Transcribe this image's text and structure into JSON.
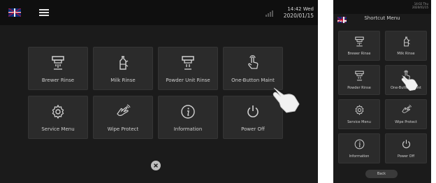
{
  "landscape": {
    "clock": {
      "time": "14:42 Wed",
      "date": "2020/01/15"
    },
    "tiles": [
      {
        "label": "Brewer Rinse",
        "icon": "brewer-rinse-icon"
      },
      {
        "label": "Milk Rinse",
        "icon": "milk-rinse-icon"
      },
      {
        "label": "Powder Unit Rinse",
        "icon": "powder-unit-rinse-icon"
      },
      {
        "label": "One-Button Maint",
        "icon": "touch-hand-icon"
      },
      {
        "label": "Service Menu",
        "icon": "gear-icon"
      },
      {
        "label": "Wipe Protect",
        "icon": "wipe-hand-icon"
      },
      {
        "label": "Information",
        "icon": "info-icon"
      },
      {
        "label": "Power Off",
        "icon": "power-icon"
      }
    ],
    "close_icon": "close-icon"
  },
  "portrait": {
    "status": {
      "time": "14:02 Thu",
      "date": "2020/01/15"
    },
    "title": "Shortcut Menu",
    "tiles": [
      {
        "label": "Brewer Rinse",
        "icon": "brewer-rinse-icon"
      },
      {
        "label": "Milk Rinse",
        "icon": "milk-rinse-icon"
      },
      {
        "label": "Powder Rinse",
        "icon": "powder-unit-rinse-icon"
      },
      {
        "label": "One-Button Maint",
        "icon": "touch-hand-icon"
      },
      {
        "label": "Service Menu",
        "icon": "gear-icon"
      },
      {
        "label": "Wipe Protect",
        "icon": "wipe-hand-icon"
      },
      {
        "label": "Information",
        "icon": "info-icon"
      },
      {
        "label": "Power Off",
        "icon": "power-icon"
      }
    ],
    "back_label": "Back"
  },
  "colors": {
    "background": "#1b1b1b",
    "tile": "#2b2b2b",
    "text": "#cfcfcf"
  }
}
